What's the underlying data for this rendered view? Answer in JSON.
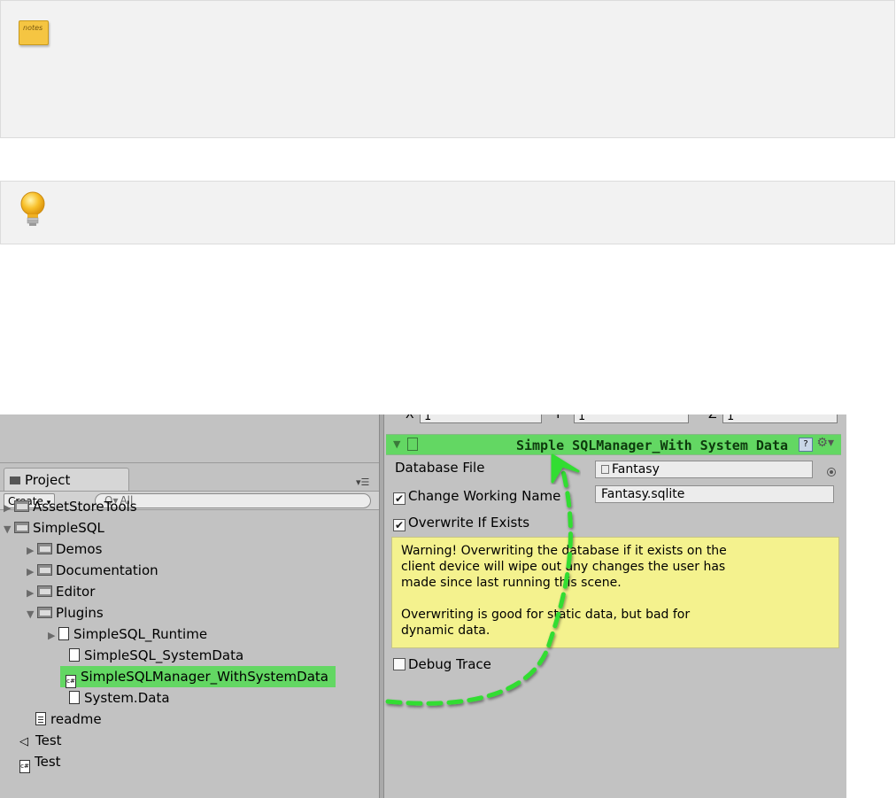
{
  "note_icon_label": "notes",
  "project": {
    "tab_label": "Project",
    "create_label": "Create",
    "search_placeholder": "All",
    "tree": [
      {
        "label": "AssetStoreTools",
        "kind": "folder",
        "arrow": "▶"
      },
      {
        "label": "SimpleSQL",
        "kind": "folder",
        "arrow": "▼"
      },
      {
        "label": "Demos",
        "kind": "folder",
        "arrow": "▶"
      },
      {
        "label": "Documentation",
        "kind": "folder",
        "arrow": "▶"
      },
      {
        "label": "Editor",
        "kind": "folder",
        "arrow": "▶"
      },
      {
        "label": "Plugins",
        "kind": "folder",
        "arrow": "▼"
      },
      {
        "label": "SimpleSQL_Runtime",
        "kind": "file",
        "arrow": "▶"
      },
      {
        "label": "SimpleSQL_SystemData",
        "kind": "file",
        "arrow": ""
      },
      {
        "label": "SimpleSQLManager_WithSystemData",
        "kind": "script",
        "arrow": "",
        "selected": true
      },
      {
        "label": "System.Data",
        "kind": "file",
        "arrow": ""
      },
      {
        "label": "readme",
        "kind": "doc",
        "arrow": ""
      },
      {
        "label": "Test",
        "kind": "scene",
        "arrow": ""
      },
      {
        "label": "Test",
        "kind": "script",
        "arrow": ""
      }
    ]
  },
  "inspector": {
    "scale_x_label": "X",
    "scale_x": "1",
    "scale_y_label": "Y",
    "scale_y": "1",
    "scale_z_label": "Z",
    "scale_z": "1",
    "component_title": "Simple SQLManager_With System Data",
    "database_file_label": "Database File",
    "database_file_value": "Fantasy",
    "change_working_name_label": "Change Working Name",
    "change_working_name_checked": true,
    "working_name_value": "Fantasy.sqlite",
    "overwrite_label": "Overwrite If Exists",
    "overwrite_checked": true,
    "warning_para1": "Warning! Overwriting the database if it exists on the\nclient device will wipe out any changes the user has\nmade since last running this scene.",
    "warning_para2": "Overwriting is good for static data, but bad for\ndynamic data.",
    "debug_trace_label": "Debug Trace",
    "debug_trace_checked": false,
    "help_icon_glyph": "?"
  },
  "colors": {
    "highlight_green": "#63d763",
    "arrow_green": "#33dd33",
    "warning_yellow": "#f4f28e",
    "panel_gray": "#c2c2c2"
  }
}
